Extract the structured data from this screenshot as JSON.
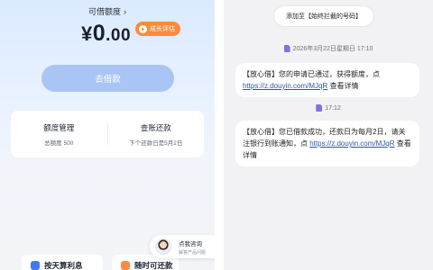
{
  "loan_app": {
    "available_label": "可借额度",
    "amount_currency": "¥",
    "amount_integer": "0",
    "amount_decimal": ".00",
    "growth_badge": "成长评估",
    "borrow_button": "去借款",
    "card": {
      "left_title": "额度管理",
      "left_sub": "总额度 500",
      "right_title": "查账还款",
      "right_sub": "下个还款日是5月2日"
    },
    "promo_1": "按天算利息",
    "promo_2": "随时可还款",
    "consult_title": "点我咨询",
    "consult_sub": "解答产品问题"
  },
  "sms": {
    "whitelist_button": "添加至【始终拦截的号码】",
    "messages": [
      {
        "timestamp": "2026年3月22日星期日 17:10",
        "pre": "【放心借】您的申请已通过，获得额度，点",
        "link": "https://z.douyin.com/MJqR",
        "post": " 查看详情"
      },
      {
        "timestamp": "17:12",
        "pre": "【放心借】您已借款成功，还款日为每月2日，请关注银行到账通知，点 ",
        "link": "https://z.douyin.com/MJqR",
        "post": " 查看详情"
      }
    ]
  },
  "colors": {
    "accent_blue": "#3d7bf5",
    "button_disabled": "#a9c5f5",
    "badge_orange": "#ff8a3d",
    "link": "#2c57a8"
  }
}
